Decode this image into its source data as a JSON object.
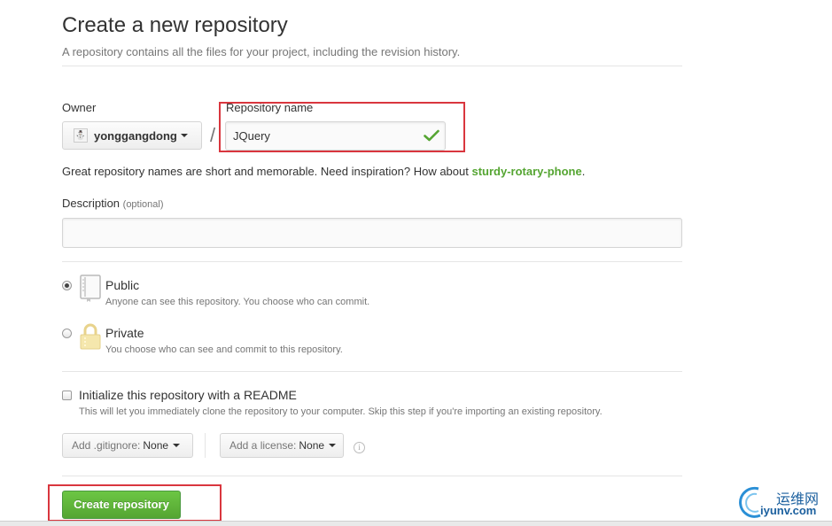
{
  "page": {
    "title": "Create a new repository",
    "subtitle": "A repository contains all the files for your project, including the revision history."
  },
  "owner": {
    "label": "Owner",
    "value": "yonggangdong"
  },
  "separator": "/",
  "repository_name": {
    "label": "Repository name",
    "value": "JQuery",
    "status_icon": "check-icon"
  },
  "inspiration": {
    "text": "Great repository names are short and memorable. Need inspiration? How about ",
    "suggestion": "sturdy-rotary-phone",
    "suffix": "."
  },
  "description": {
    "label": "Description",
    "optional": "(optional)",
    "value": ""
  },
  "visibility": {
    "public": {
      "title": "Public",
      "description": "Anyone can see this repository. You choose who can commit.",
      "icon": "book-icon",
      "selected": true
    },
    "private": {
      "title": "Private",
      "description": "You choose who can see and commit to this repository.",
      "icon": "lock-icon",
      "selected": false
    }
  },
  "readme": {
    "label": "Initialize this repository with a README",
    "description": "This will let you immediately clone the repository to your computer. Skip this step if you're importing an existing repository.",
    "checked": false
  },
  "gitignore": {
    "label": "Add .gitignore:",
    "value": "None"
  },
  "license": {
    "label": "Add a license:",
    "value": "None",
    "info_icon": "i"
  },
  "submit": {
    "label": "Create repository"
  },
  "watermark": {
    "cn": "运维网",
    "en": "iyunv.com"
  },
  "colors": {
    "accent_green": "#55a532",
    "highlight_red": "#d9363e",
    "watermark_blue": "#1a5f9e"
  }
}
